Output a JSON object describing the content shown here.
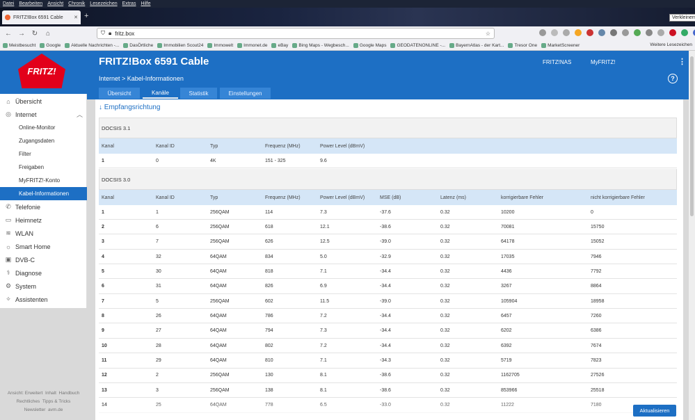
{
  "browser": {
    "menu": [
      "Datei",
      "Bearbeiten",
      "Ansicht",
      "Chronik",
      "Lesezeichen",
      "Extras",
      "Hilfe"
    ],
    "tab_title": "FRITZ!Box 6591 Cable",
    "restore_tooltip": "Verkleinern",
    "url": "fritz.box",
    "bookmarks": [
      "Meistbesucht",
      "Google",
      "Aktuelle Nachrichten -...",
      "DasÖrtliche",
      "Immobilien Scout24",
      "Immowelt",
      "Immonet.de",
      "eBay",
      "Bing Maps - Wegbesch...",
      "Google Maps",
      "GEODATENONLINE -...",
      "BayernAtlas - der Kart...",
      "Tresor One",
      "MarketScreener"
    ],
    "bookmarks_right": "Weitere Lesezeichen"
  },
  "header": {
    "logo": "FRITZ!",
    "title": "FRITZ!Box 6591 Cable",
    "link1": "FRITZ!NAS",
    "link2": "MyFRITZ!",
    "breadcrumb": "Internet > Kabel-Informationen",
    "help": "?"
  },
  "tabs": [
    "Übersicht",
    "Kanäle",
    "Statistik",
    "Einstellungen"
  ],
  "sidebar": [
    {
      "label": "Übersicht",
      "icon": "home-icon"
    },
    {
      "label": "Internet",
      "icon": "globe-icon"
    },
    {
      "label": "Online-Monitor"
    },
    {
      "label": "Zugangsdaten"
    },
    {
      "label": "Filter"
    },
    {
      "label": "Freigaben"
    },
    {
      "label": "MyFRITZ!-Konto"
    },
    {
      "label": "Kabel-Informationen"
    },
    {
      "label": "Telefonie",
      "icon": "phone-icon"
    },
    {
      "label": "Heimnetz",
      "icon": "network-icon"
    },
    {
      "label": "WLAN",
      "icon": "wifi-icon"
    },
    {
      "label": "Smart Home",
      "icon": "bulb-icon"
    },
    {
      "label": "DVB-C",
      "icon": "tv-icon"
    },
    {
      "label": "Diagnose",
      "icon": "stethoscope-icon"
    },
    {
      "label": "System",
      "icon": "gear-icon"
    },
    {
      "label": "Assistenten",
      "icon": "wizard-icon"
    }
  ],
  "sidebar_footer": [
    "Ansicht: Erweitert",
    "Inhalt",
    "Handbuch",
    "Rechtliches",
    "Tipps & Tricks",
    "Newsletter",
    "avm.de"
  ],
  "section": "↓ Empfangsrichtung",
  "docsis31": {
    "label": "DOCSIS 3.1",
    "headers": [
      "Kanal",
      "Kanal ID",
      "Typ",
      "Frequenz (MHz)",
      "Power Level (dBmV)"
    ],
    "rows": [
      [
        "1",
        "0",
        "4K",
        "151 - 325",
        "9.6"
      ]
    ]
  },
  "docsis30": {
    "label": "DOCSIS 3.0",
    "headers": [
      "Kanal",
      "Kanal ID",
      "Typ",
      "Frequenz (MHz)",
      "Power Level (dBmV)",
      "MSE (dB)",
      "Latenz (ms)",
      "korrigierbare Fehler",
      "nicht korrigierbare Fehler"
    ],
    "rows": [
      [
        "1",
        "1",
        "256QAM",
        "114",
        "7.3",
        "-37.6",
        "0.32",
        "10200",
        "0"
      ],
      [
        "2",
        "6",
        "256QAM",
        "618",
        "12.1",
        "-38.6",
        "0.32",
        "70081",
        "15750"
      ],
      [
        "3",
        "7",
        "256QAM",
        "626",
        "12.5",
        "-39.0",
        "0.32",
        "64178",
        "15052"
      ],
      [
        "4",
        "32",
        "64QAM",
        "834",
        "5.0",
        "-32.9",
        "0.32",
        "17035",
        "7946"
      ],
      [
        "5",
        "30",
        "64QAM",
        "818",
        "7.1",
        "-34.4",
        "0.32",
        "4436",
        "7792"
      ],
      [
        "6",
        "31",
        "64QAM",
        "826",
        "6.9",
        "-34.4",
        "0.32",
        "3267",
        "8864"
      ],
      [
        "7",
        "5",
        "256QAM",
        "602",
        "11.5",
        "-39.0",
        "0.32",
        "105904",
        "18958"
      ],
      [
        "8",
        "26",
        "64QAM",
        "786",
        "7.2",
        "-34.4",
        "0.32",
        "6457",
        "7260"
      ],
      [
        "9",
        "27",
        "64QAM",
        "794",
        "7.3",
        "-34.4",
        "0.32",
        "6202",
        "6386"
      ],
      [
        "10",
        "28",
        "64QAM",
        "802",
        "7.2",
        "-34.4",
        "0.32",
        "6392",
        "7674"
      ],
      [
        "11",
        "29",
        "64QAM",
        "810",
        "7.1",
        "-34.3",
        "0.32",
        "5719",
        "7823"
      ],
      [
        "12",
        "2",
        "256QAM",
        "130",
        "8.1",
        "-38.6",
        "0.32",
        "1162705",
        "27526"
      ],
      [
        "13",
        "3",
        "256QAM",
        "138",
        "8.1",
        "-38.6",
        "0.32",
        "853966",
        "25518"
      ],
      [
        "14",
        "25",
        "64QAM",
        "778",
        "6.5",
        "-33.0",
        "0.32",
        "11222",
        "7180"
      ]
    ]
  },
  "refresh_button": "Aktualisieren"
}
